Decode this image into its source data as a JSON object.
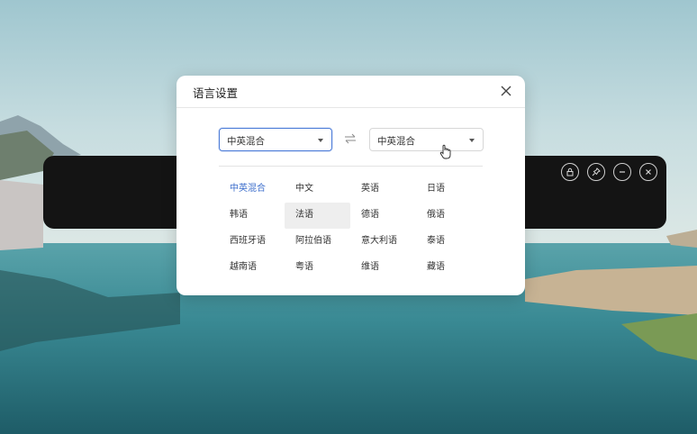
{
  "dialog": {
    "title": "语言设置",
    "source_language": "中英混合",
    "target_language": "中英混合",
    "languages": [
      {
        "label": "中英混合",
        "state": "selected"
      },
      {
        "label": "中文",
        "state": ""
      },
      {
        "label": "英语",
        "state": ""
      },
      {
        "label": "日语",
        "state": ""
      },
      {
        "label": "韩语",
        "state": ""
      },
      {
        "label": "法语",
        "state": "hover"
      },
      {
        "label": "德语",
        "state": ""
      },
      {
        "label": "俄语",
        "state": ""
      },
      {
        "label": "西班牙语",
        "state": ""
      },
      {
        "label": "阿拉伯语",
        "state": ""
      },
      {
        "label": "意大利语",
        "state": ""
      },
      {
        "label": "泰语",
        "state": ""
      },
      {
        "label": "越南语",
        "state": ""
      },
      {
        "label": "粤语",
        "state": ""
      },
      {
        "label": "维语",
        "state": ""
      },
      {
        "label": "藏语",
        "state": ""
      }
    ]
  },
  "subtitle_bar": {
    "controls": [
      "lock-icon",
      "pin-icon",
      "minimize-icon",
      "close-icon"
    ]
  },
  "colors": {
    "accent": "#3e6fcc",
    "bar_bg": "#141414",
    "hover_bg": "#eeeeee"
  }
}
